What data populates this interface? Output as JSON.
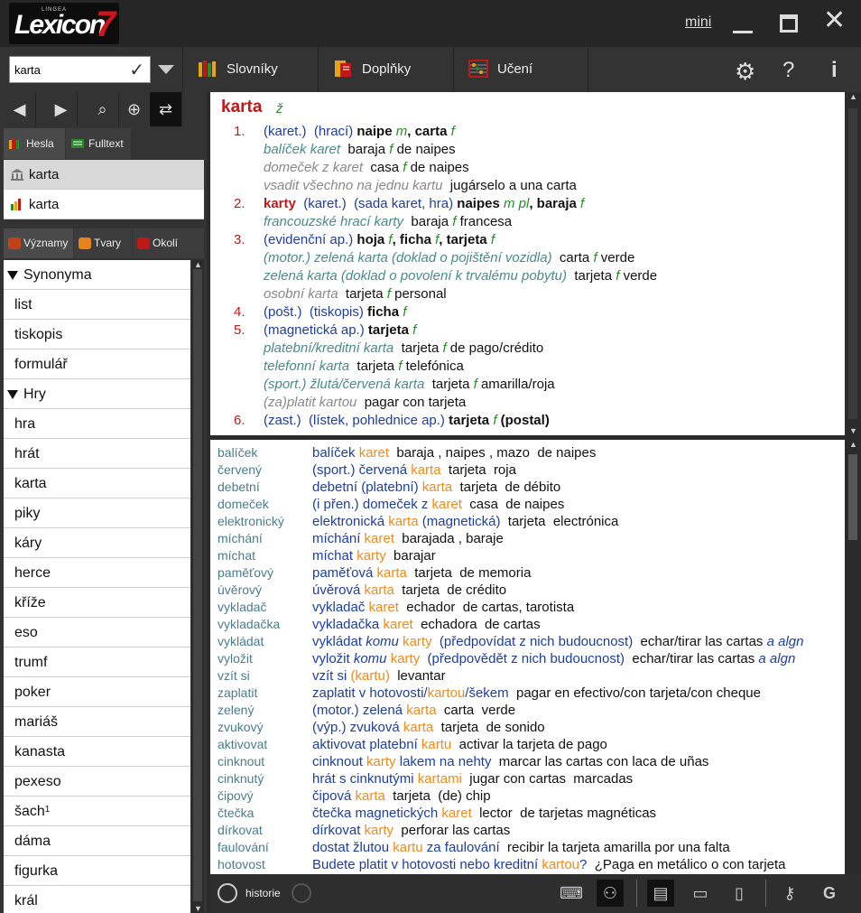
{
  "app": {
    "brand_small": "LINGEA",
    "brand": "Lexicon",
    "brand_version": "7",
    "mini_label": "mini"
  },
  "search": {
    "value": "karta"
  },
  "toolbar": {
    "dict_label": "Slovníky",
    "addons_label": "Doplňky",
    "learn_label": "Učení"
  },
  "left": {
    "tab_hesla": "Hesla",
    "tab_fulltext": "Fulltext",
    "hits": [
      {
        "label": "karta"
      },
      {
        "label": "karta"
      }
    ],
    "tab_vyznamy": "Významy",
    "tab_tvary": "Tvary",
    "tab_okoli": "Okolí",
    "synonyms": [
      {
        "label": "Synonyma",
        "group": true
      },
      {
        "label": "list"
      },
      {
        "label": "tiskopis"
      },
      {
        "label": "formulář"
      },
      {
        "label": "Hry",
        "group": true
      },
      {
        "label": "hra"
      },
      {
        "label": "hrát"
      },
      {
        "label": "karta"
      },
      {
        "label": "piky"
      },
      {
        "label": "káry"
      },
      {
        "label": "herce"
      },
      {
        "label": "kříže"
      },
      {
        "label": "eso"
      },
      {
        "label": "trumf"
      },
      {
        "label": "poker"
      },
      {
        "label": "mariáš"
      },
      {
        "label": "kanasta"
      },
      {
        "label": "pexeso"
      },
      {
        "label": "šach",
        "sup": "1"
      },
      {
        "label": "dáma"
      },
      {
        "label": "figurka"
      },
      {
        "label": "král"
      }
    ]
  },
  "entry": {
    "headword": "karta",
    "gender": "ž",
    "lines": [
      {
        "num": "1.",
        "parts": [
          [
            "blue",
            "(karet.)"
          ],
          [
            "bl",
            "  "
          ],
          [
            "blue",
            "(hrací)"
          ],
          [
            "bl",
            " "
          ],
          [
            "b",
            "naipe"
          ],
          [
            "bl",
            " "
          ],
          [
            "grn",
            "m"
          ],
          [
            "b",
            ", carta"
          ],
          [
            "bl",
            " "
          ],
          [
            "grn",
            "f"
          ]
        ]
      },
      {
        "parts": [
          [
            "teal",
            "balíček karet"
          ],
          [
            "bl",
            "  baraja "
          ],
          [
            "grn",
            "f"
          ],
          [
            "bl",
            " de naipes"
          ]
        ]
      },
      {
        "parts": [
          [
            "gray",
            "domeček z karet"
          ],
          [
            "bl",
            "  casa "
          ],
          [
            "grn",
            "f"
          ],
          [
            "bl",
            " de naipes"
          ]
        ]
      },
      {
        "parts": [
          [
            "gray",
            "vsadit všechno na jednu kartu"
          ],
          [
            "bl",
            "  jugárselo a una carta"
          ]
        ]
      },
      {
        "num": "2.",
        "parts": [
          [
            "red",
            "karty"
          ],
          [
            "bl",
            "  "
          ],
          [
            "blue",
            "(karet.)"
          ],
          [
            "bl",
            "  "
          ],
          [
            "blue",
            "(sada karet, hra)"
          ],
          [
            "bl",
            " "
          ],
          [
            "b",
            "naipes"
          ],
          [
            "bl",
            " "
          ],
          [
            "grn",
            "m pl"
          ],
          [
            "b",
            ", baraja"
          ],
          [
            "bl",
            " "
          ],
          [
            "grn",
            "f"
          ]
        ]
      },
      {
        "parts": [
          [
            "teal",
            "francouzské hrací karty"
          ],
          [
            "bl",
            "  baraja "
          ],
          [
            "grn",
            "f"
          ],
          [
            "bl",
            " francesa"
          ]
        ]
      },
      {
        "num": "3.",
        "parts": [
          [
            "blue",
            "(evidenční ap.)"
          ],
          [
            "bl",
            " "
          ],
          [
            "b",
            "hoja"
          ],
          [
            "bl",
            " "
          ],
          [
            "grn",
            "f"
          ],
          [
            "b",
            ", ficha"
          ],
          [
            "bl",
            " "
          ],
          [
            "grn",
            "f"
          ],
          [
            "b",
            ", tarjeta"
          ],
          [
            "bl",
            " "
          ],
          [
            "grn",
            "f"
          ]
        ]
      },
      {
        "parts": [
          [
            "teal",
            "(motor.) zelená karta (doklad o pojištění vozidla)"
          ],
          [
            "bl",
            "  carta "
          ],
          [
            "grn",
            "f"
          ],
          [
            "bl",
            " verde"
          ]
        ]
      },
      {
        "parts": [
          [
            "teal",
            "zelená karta (doklad o povolení k trvalému pobytu)"
          ],
          [
            "bl",
            "  tarjeta "
          ],
          [
            "grn",
            "f"
          ],
          [
            "bl",
            " verde"
          ]
        ]
      },
      {
        "parts": [
          [
            "gray",
            "osobní karta"
          ],
          [
            "bl",
            "  tarjeta "
          ],
          [
            "grn",
            "f"
          ],
          [
            "bl",
            " personal"
          ]
        ]
      },
      {
        "num": "4.",
        "parts": [
          [
            "blue",
            "(pošt.)"
          ],
          [
            "bl",
            "  "
          ],
          [
            "blue",
            "(tiskopis)"
          ],
          [
            "bl",
            " "
          ],
          [
            "b",
            "ficha"
          ],
          [
            "bl",
            " "
          ],
          [
            "grn",
            "f"
          ]
        ]
      },
      {
        "num": "5.",
        "parts": [
          [
            "blue",
            "(magnetická ap.)"
          ],
          [
            "bl",
            " "
          ],
          [
            "b",
            "tarjeta"
          ],
          [
            "bl",
            " "
          ],
          [
            "grn",
            "f"
          ]
        ]
      },
      {
        "parts": [
          [
            "teal",
            "platební/kreditní karta"
          ],
          [
            "bl",
            "  tarjeta "
          ],
          [
            "grn",
            "f"
          ],
          [
            "bl",
            " de pago/crédito"
          ]
        ]
      },
      {
        "parts": [
          [
            "teal",
            "telefonní karta"
          ],
          [
            "bl",
            "  tarjeta "
          ],
          [
            "grn",
            "f"
          ],
          [
            "bl",
            " telefónica"
          ]
        ]
      },
      {
        "parts": [
          [
            "teal",
            "(sport.) žlutá/červená karta"
          ],
          [
            "bl",
            "  tarjeta "
          ],
          [
            "grn",
            "f"
          ],
          [
            "bl",
            " amarilla/roja"
          ]
        ]
      },
      {
        "parts": [
          [
            "gray",
            "(za)platit kartou"
          ],
          [
            "bl",
            "  pagar con tarjeta"
          ]
        ]
      },
      {
        "num": "6.",
        "parts": [
          [
            "blue",
            "(zast.)"
          ],
          [
            "bl",
            "  "
          ],
          [
            "blue",
            "(lístek, pohlednice ap.)"
          ],
          [
            "bl",
            " "
          ],
          [
            "b",
            "tarjeta"
          ],
          [
            "bl",
            " "
          ],
          [
            "grn",
            "f"
          ],
          [
            "b",
            " (postal)"
          ]
        ]
      }
    ]
  },
  "examples": [
    {
      "k": "balíček",
      "parts": [
        [
          "ebl",
          "balíček "
        ],
        [
          "or",
          "karet"
        ],
        [
          "bl",
          "  baraja , naipes , mazo  de naipes"
        ]
      ]
    },
    {
      "k": "červený",
      "parts": [
        [
          "ebl",
          "(sport.) červená "
        ],
        [
          "or",
          "karta"
        ],
        [
          "bl",
          "  tarjeta  roja"
        ]
      ]
    },
    {
      "k": "debetní",
      "parts": [
        [
          "ebl",
          "debetní (platební) "
        ],
        [
          "or",
          "karta"
        ],
        [
          "bl",
          "  tarjeta  de débito"
        ]
      ]
    },
    {
      "k": "domeček",
      "parts": [
        [
          "ebl",
          "(i přen.) domeček z "
        ],
        [
          "or",
          "karet"
        ],
        [
          "bl",
          "  casa  de naipes"
        ]
      ]
    },
    {
      "k": "elektronický",
      "parts": [
        [
          "ebl",
          "elektronická "
        ],
        [
          "or",
          "karta"
        ],
        [
          "ebl",
          " (magnetická)"
        ],
        [
          "bl",
          "  tarjeta  electrónica"
        ]
      ]
    },
    {
      "k": "míchání",
      "parts": [
        [
          "ebl",
          "míchání "
        ],
        [
          "or",
          "karet"
        ],
        [
          "bl",
          "  barajada , baraje"
        ]
      ]
    },
    {
      "k": "míchat",
      "parts": [
        [
          "ebl",
          "míchat "
        ],
        [
          "or",
          "karty"
        ],
        [
          "bl",
          "  barajar"
        ]
      ]
    },
    {
      "k": "paměťový",
      "parts": [
        [
          "ebl",
          "paměťová "
        ],
        [
          "or",
          "karta"
        ],
        [
          "bl",
          "  tarjeta  de memoria"
        ]
      ]
    },
    {
      "k": "úvěrový",
      "parts": [
        [
          "ebl",
          "úvěrová "
        ],
        [
          "or",
          "karta"
        ],
        [
          "bl",
          "  tarjeta  de crédito"
        ]
      ]
    },
    {
      "k": "vykladač",
      "parts": [
        [
          "ebl",
          "vykladač "
        ],
        [
          "or",
          "karet"
        ],
        [
          "bl",
          "  echador  de cartas, tarotista"
        ]
      ]
    },
    {
      "k": "vykladačka",
      "parts": [
        [
          "ebl",
          "vykladačka "
        ],
        [
          "or",
          "karet"
        ],
        [
          "bl",
          "  echadora  de cartas"
        ]
      ]
    },
    {
      "k": "vykládat",
      "parts": [
        [
          "ebl",
          "vykládat "
        ],
        [
          "ebli",
          "komu"
        ],
        [
          "ebl",
          " "
        ],
        [
          "or",
          "karty"
        ],
        [
          "ebl",
          "  (předpovídat z nich budoucnost)"
        ],
        [
          "bl",
          "  echar/tirar las cartas "
        ],
        [
          "ebli",
          "a algn"
        ]
      ]
    },
    {
      "k": "vyložit",
      "parts": [
        [
          "ebl",
          "vyložit "
        ],
        [
          "ebli",
          "komu"
        ],
        [
          "ebl",
          " "
        ],
        [
          "or",
          "karty"
        ],
        [
          "ebl",
          "  (předpovědět z nich budoucnost)"
        ],
        [
          "bl",
          "  echar/tirar las cartas "
        ],
        [
          "ebli",
          "a algn"
        ]
      ]
    },
    {
      "k": "vzít si",
      "parts": [
        [
          "ebl",
          "vzít si "
        ],
        [
          "or",
          "(kartu)"
        ],
        [
          "bl",
          "  levantar"
        ]
      ]
    },
    {
      "k": "zaplatit",
      "parts": [
        [
          "ebl",
          "zaplatit v hotovosti/"
        ],
        [
          "or",
          "kartou"
        ],
        [
          "ebl",
          "/šekem"
        ],
        [
          "bl",
          "  pagar en efectivo/con tarjeta/con cheque"
        ]
      ]
    },
    {
      "k": "zelený",
      "parts": [
        [
          "ebl",
          "(motor.) zelená "
        ],
        [
          "or",
          "karta"
        ],
        [
          "bl",
          "  carta  verde"
        ]
      ]
    },
    {
      "k": "zvukový",
      "parts": [
        [
          "ebl",
          "(výp.) zvuková "
        ],
        [
          "or",
          "karta"
        ],
        [
          "bl",
          "  tarjeta  de sonido"
        ]
      ]
    },
    {
      "k": "aktivovat",
      "parts": [
        [
          "ebl",
          "aktivovat platební "
        ],
        [
          "or",
          "kartu"
        ],
        [
          "bl",
          "  activar la tarjeta de pago"
        ]
      ]
    },
    {
      "k": "cinknout",
      "parts": [
        [
          "ebl",
          "cinknout "
        ],
        [
          "or",
          "karty"
        ],
        [
          "ebl",
          " lakem na nehty"
        ],
        [
          "bl",
          "  marcar las cartas con laca de uñas"
        ]
      ]
    },
    {
      "k": "cinknutý",
      "parts": [
        [
          "ebl",
          "hrát s cinknutými "
        ],
        [
          "or",
          "kartami"
        ],
        [
          "bl",
          "  jugar con cartas  marcadas"
        ]
      ]
    },
    {
      "k": "čipový",
      "parts": [
        [
          "ebl",
          "čipová "
        ],
        [
          "or",
          "karta"
        ],
        [
          "bl",
          "  tarjeta  (de) chip"
        ]
      ]
    },
    {
      "k": "čtečka",
      "parts": [
        [
          "ebl",
          "čtečka magnetických "
        ],
        [
          "or",
          "karet"
        ],
        [
          "bl",
          "  lector  de tarjetas magnéticas"
        ]
      ]
    },
    {
      "k": "dírkovat",
      "parts": [
        [
          "ebl",
          "dírkovat "
        ],
        [
          "or",
          "karty"
        ],
        [
          "bl",
          "  perforar las cartas"
        ]
      ]
    },
    {
      "k": "faulování",
      "parts": [
        [
          "ebl",
          "dostat žlutou "
        ],
        [
          "or",
          "kartu"
        ],
        [
          "ebl",
          " za faulování"
        ],
        [
          "bl",
          "  recibir la tarjeta amarilla por una falta"
        ]
      ]
    },
    {
      "k": "hotovost",
      "parts": [
        [
          "ebl",
          "Budete platit v hotovosti nebo kreditní "
        ],
        [
          "or",
          "kartou"
        ],
        [
          "ebl",
          "?"
        ],
        [
          "bl",
          "  ¿Paga en metálico o con tarjeta"
        ]
      ]
    }
  ],
  "footer": {
    "history_label": "historie"
  },
  "colors": {
    "accent_red": "#c01818",
    "orange_highlight": "#f08a1a",
    "blue_text": "#1e3e9e",
    "gender_green": "#2a8a2a"
  }
}
